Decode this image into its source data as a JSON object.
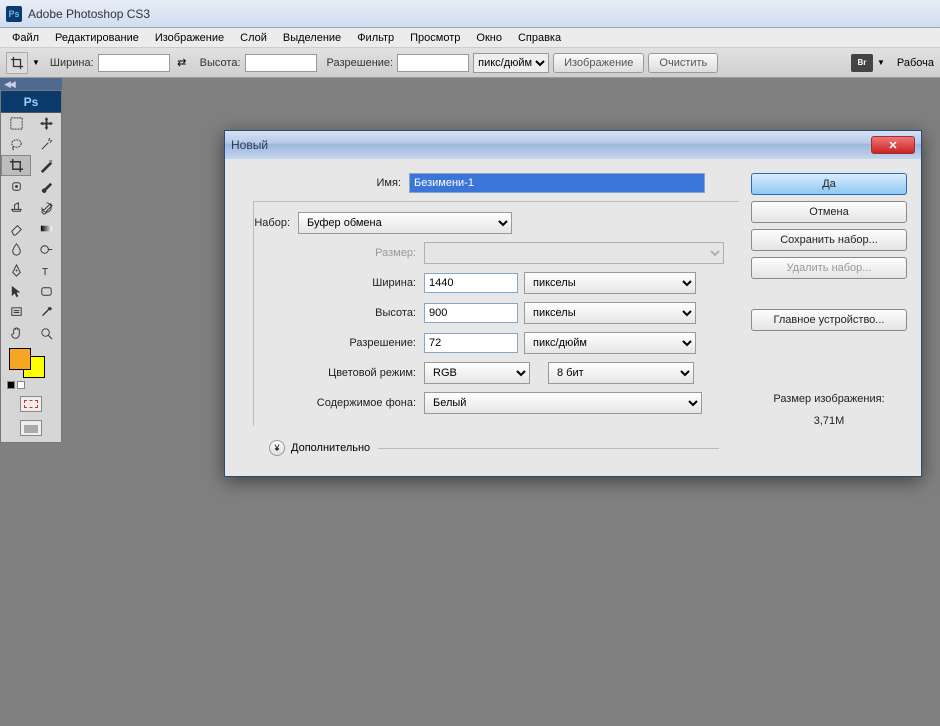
{
  "titlebar": {
    "title": "Adobe Photoshop CS3"
  },
  "menu": {
    "items": [
      "Файл",
      "Редактирование",
      "Изображение",
      "Слой",
      "Выделение",
      "Фильтр",
      "Просмотр",
      "Окно",
      "Справка"
    ]
  },
  "options": {
    "width_label": "Ширина:",
    "height_label": "Высота:",
    "resolution_label": "Разрешение:",
    "resolution_unit": "пикс/дюйм",
    "btn_front": "Изображение",
    "btn_clear": "Очистить",
    "workspace_label": "Рабоча"
  },
  "dialog": {
    "title": "Новый",
    "name_label": "Имя:",
    "name_value": "Безимени-1",
    "preset_label": "Набор:",
    "preset_value": "Буфер обмена",
    "size_label": "Размер:",
    "width_label": "Ширина:",
    "width_value": "1440",
    "width_unit": "пикселы",
    "height_label": "Высота:",
    "height_value": "900",
    "height_unit": "пикселы",
    "resolution_label": "Разрешение:",
    "resolution_value": "72",
    "resolution_unit": "пикс/дюйм",
    "mode_label": "Цветовой режим:",
    "mode_value": "RGB",
    "bit_value": "8 бит",
    "bgcontents_label": "Содержимое фона:",
    "bgcontents_value": "Белый",
    "advanced_label": "Дополнительно",
    "btn_ok": "Да",
    "btn_cancel": "Отмена",
    "btn_save_preset": "Сохранить набор...",
    "btn_delete_preset": "Удалить набор...",
    "btn_device_central": "Главное устройство...",
    "image_size_label": "Размер изображения:",
    "image_size_value": "3,71M"
  }
}
